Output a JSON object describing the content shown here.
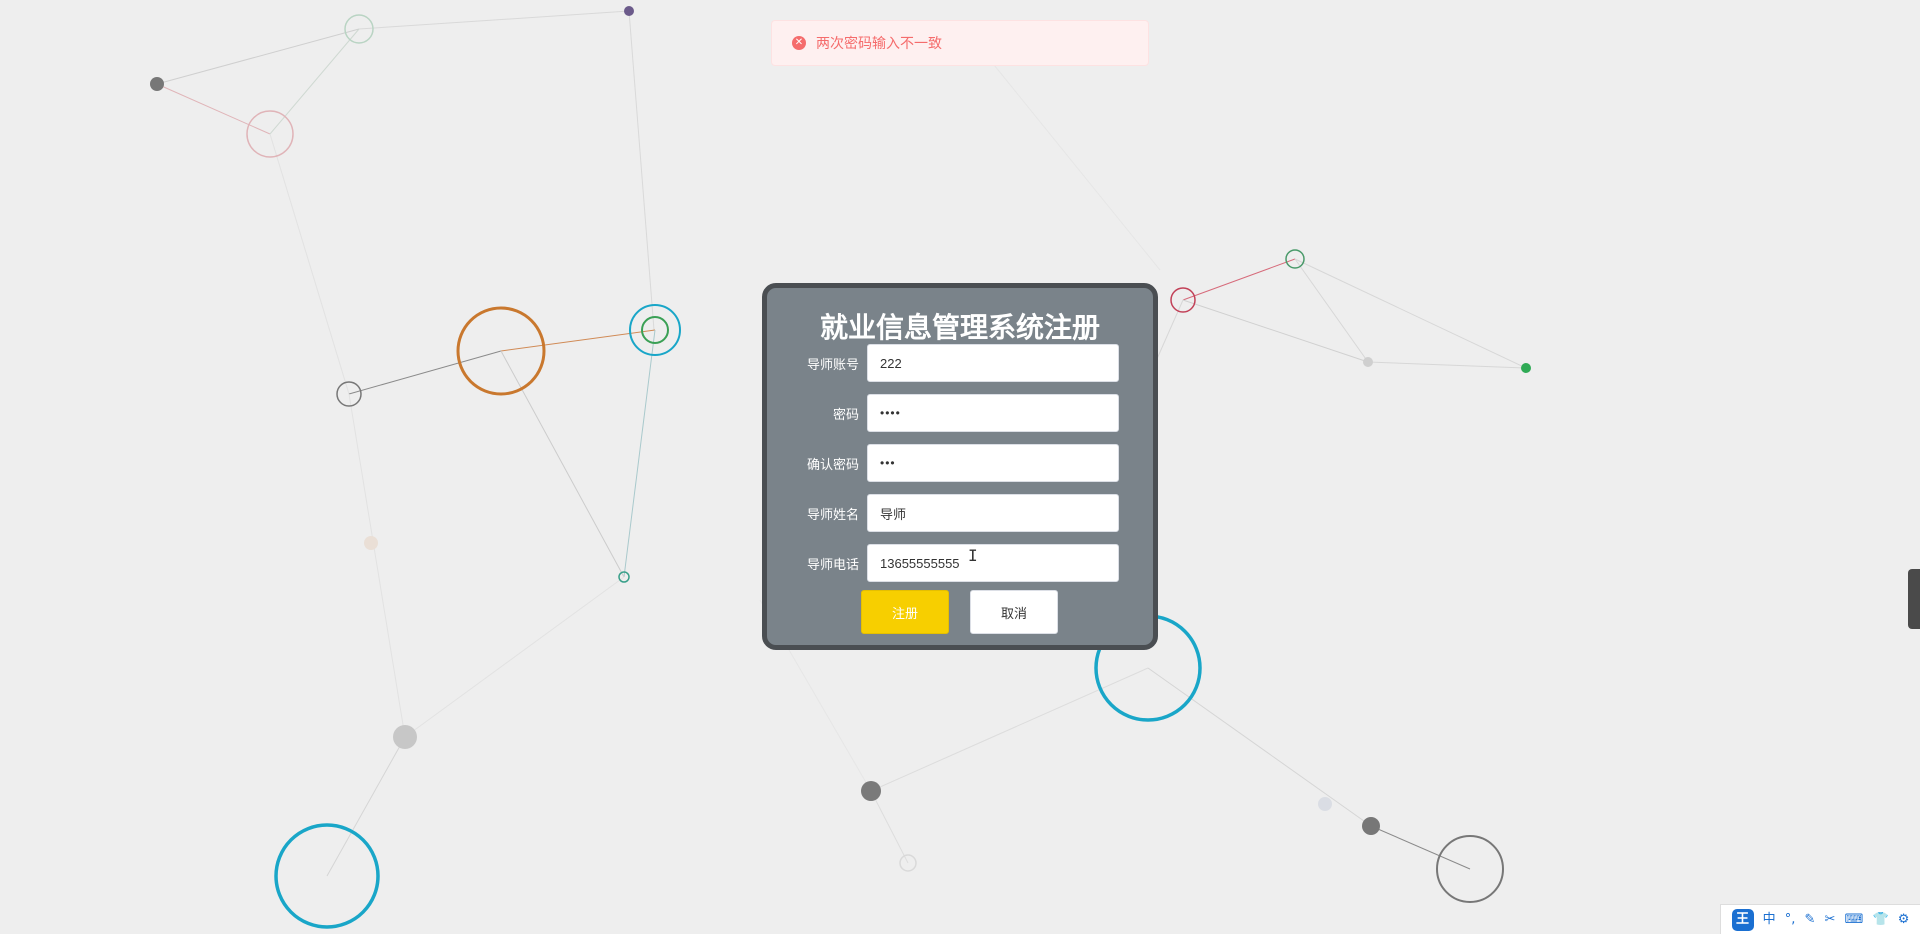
{
  "toast": {
    "message": "两次密码输入不一致",
    "icon": "error-circle-icon",
    "color": "#f56c6c"
  },
  "form": {
    "title": "就业信息管理系统注册",
    "fields": [
      {
        "label": "导师账号",
        "value": "222"
      },
      {
        "label": "密码",
        "value": "••••"
      },
      {
        "label": "确认密码",
        "value": "•••"
      },
      {
        "label": "导师姓名",
        "value": "导师"
      },
      {
        "label": "导师电话",
        "value": "13655555555"
      }
    ],
    "register_label": "注册",
    "cancel_label": "取消",
    "accent_color": "#f7cf00"
  },
  "ime_toolbar": {
    "logo": "王",
    "mode": "中",
    "punct": "°,",
    "icons": [
      "pen-icon",
      "scissors-icon",
      "keyboard-icon",
      "shirt-icon",
      "gear-icon"
    ]
  }
}
